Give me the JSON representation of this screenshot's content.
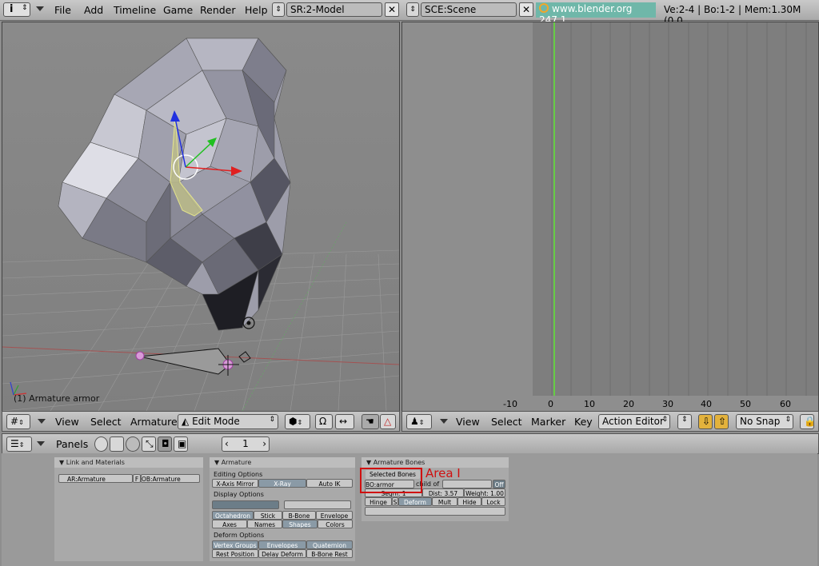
{
  "menubar": {
    "items": [
      "File",
      "Add",
      "Timeline",
      "Game",
      "Render",
      "Help"
    ],
    "screen": "SR:2-Model",
    "scene": "SCE:Scene",
    "link": "www.blender.org 247.1",
    "stats": "Ve:2-4 | Bo:1-2 | Mem:1.30M (0.0"
  },
  "viewport": {
    "label": "(1) Armature armor",
    "menus": [
      "View",
      "Select",
      "Armature"
    ],
    "mode": "Edit Mode"
  },
  "action_editor": {
    "ticks": [
      "-10",
      "0",
      "10",
      "20",
      "30",
      "40",
      "50",
      "60"
    ],
    "menus": [
      "View",
      "Select",
      "Marker",
      "Key"
    ],
    "editor": "Action Editor",
    "snap": "No Snap"
  },
  "buttons": {
    "panels_label": "Panels",
    "frame": "1",
    "link_materials": {
      "title": "Link and Materials",
      "armature_field": "AR:Armature",
      "f_label": "F",
      "object_field": "OB:Armature"
    },
    "armature": {
      "title": "Armature",
      "editing_options": "Editing Options",
      "x_axis_mirror": "X-Axis Mirror",
      "x_ray": "X-Ray",
      "auto_ik": "Auto IK",
      "display_options": "Display Options",
      "octahedron": "Octahedron",
      "stick": "Stick",
      "b_bone": "B-Bone",
      "envelope": "Envelope",
      "axes": "Axes",
      "names": "Names",
      "shapes": "Shapes",
      "colors": "Colors",
      "deform_options": "Deform Options",
      "vertex_groups": "Vertex Groups",
      "envelopes": "Envelopes",
      "quaternion": "Quaternion",
      "rest_position": "Rest Position",
      "delay_deform": "Delay Deform",
      "b_bone_rest": "B-Bone Rest"
    },
    "armature_bones": {
      "title": "Armature Bones",
      "selected_bones": "Selected Bones",
      "bone_name": "BO:armor",
      "child_of": "child of",
      "off": "Off",
      "segm": "Segm: 1",
      "dist": "Dist: 3.57",
      "weight": "Weight: 1.00",
      "hinge": "Hinge",
      "s": "S",
      "deform": "Deform",
      "mult": "Mult",
      "hide": "Hide",
      "lock": "Lock"
    },
    "annotation": "Area I"
  }
}
